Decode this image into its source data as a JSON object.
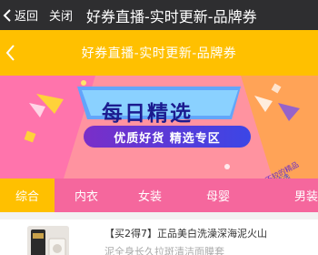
{
  "titlebar": {
    "back_label": "返回",
    "close_label": "关闭",
    "title": "好券直播-实时更新-品牌券"
  },
  "header": {
    "title": "好券直播-实时更新-品牌券",
    "color": "#ffc000"
  },
  "banner": {
    "main_text": "每日精选",
    "sub_text": "优质好货 精选专区",
    "tag_text": "品牌信誉不较的精品",
    "tag_text_2": "精选"
  },
  "tabs": [
    {
      "label": "综合",
      "active": true
    },
    {
      "label": "内衣",
      "active": false
    },
    {
      "label": "女装",
      "active": false
    },
    {
      "label": "母婴",
      "active": false
    },
    {
      "label": "男装",
      "active": false
    }
  ],
  "product": {
    "title": "【买2得7】正品美白洗澡深海泥火山",
    "desc": "泥全身长久拉斑清洁面膜套"
  },
  "colors": {
    "titlebar_bg": "#2e2e30",
    "tabs_bg": "#f5679d",
    "active_tab": "#ffc000"
  }
}
